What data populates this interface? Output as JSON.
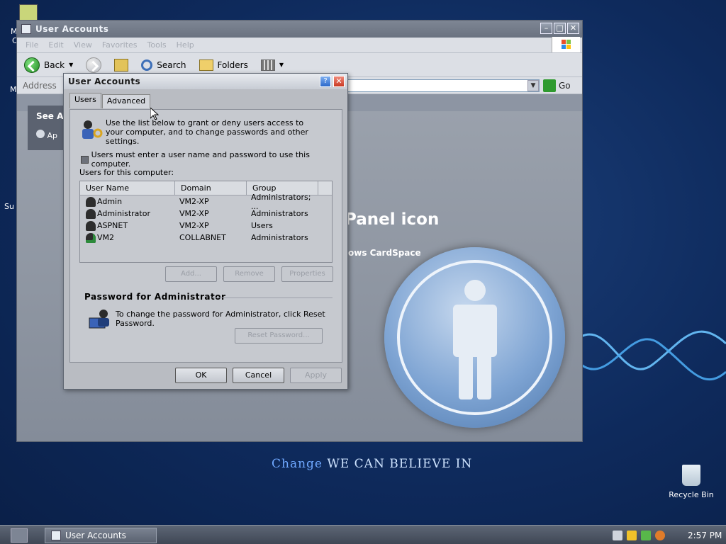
{
  "desktop": {
    "slogan_a": "Change",
    "slogan_b": " we can believe in",
    "recycle_bin": "Recycle Bin",
    "partial_labels": [
      "M",
      "C",
      "M",
      "Su"
    ]
  },
  "explorer": {
    "title": "User Accounts",
    "menu": [
      "File",
      "Edit",
      "View",
      "Favorites",
      "Tools",
      "Help"
    ],
    "toolbar": {
      "back": "Back",
      "search": "Search",
      "folders": "Folders"
    },
    "address_label": "Address",
    "go": "Go",
    "see_also": "See Al",
    "see_also_item": "Ap",
    "panel_text": "Panel icon",
    "cardspace_text": "ows CardSpace"
  },
  "dialog": {
    "title": "User Accounts",
    "tabs": [
      "Users",
      "Advanced"
    ],
    "intro": "Use the list below to grant or deny users access to your computer, and to change passwords and other settings.",
    "checkbox": "Users must enter a user name and password to use this computer.",
    "users_label": "Users for this computer:",
    "columns": [
      "User Name",
      "Domain",
      "Group"
    ],
    "users": [
      {
        "name": "Admin",
        "domain": "VM2-XP",
        "group": "Administrators; ..."
      },
      {
        "name": "Administrator",
        "domain": "VM2-XP",
        "group": "Administrators"
      },
      {
        "name": "ASPNET",
        "domain": "VM2-XP",
        "group": "Users"
      },
      {
        "name": "VM2",
        "domain": "COLLABNET",
        "group": "Administrators"
      }
    ],
    "buttons": {
      "add": "Add...",
      "remove": "Remove",
      "properties": "Properties"
    },
    "pw_group": "Password for Administrator",
    "pw_text": "To change the password for Administrator, click Reset Password.",
    "reset": "Reset Password...",
    "ok": "OK",
    "cancel": "Cancel",
    "apply": "Apply"
  },
  "taskbar": {
    "task": "User Accounts",
    "clock": "2:57 PM"
  }
}
